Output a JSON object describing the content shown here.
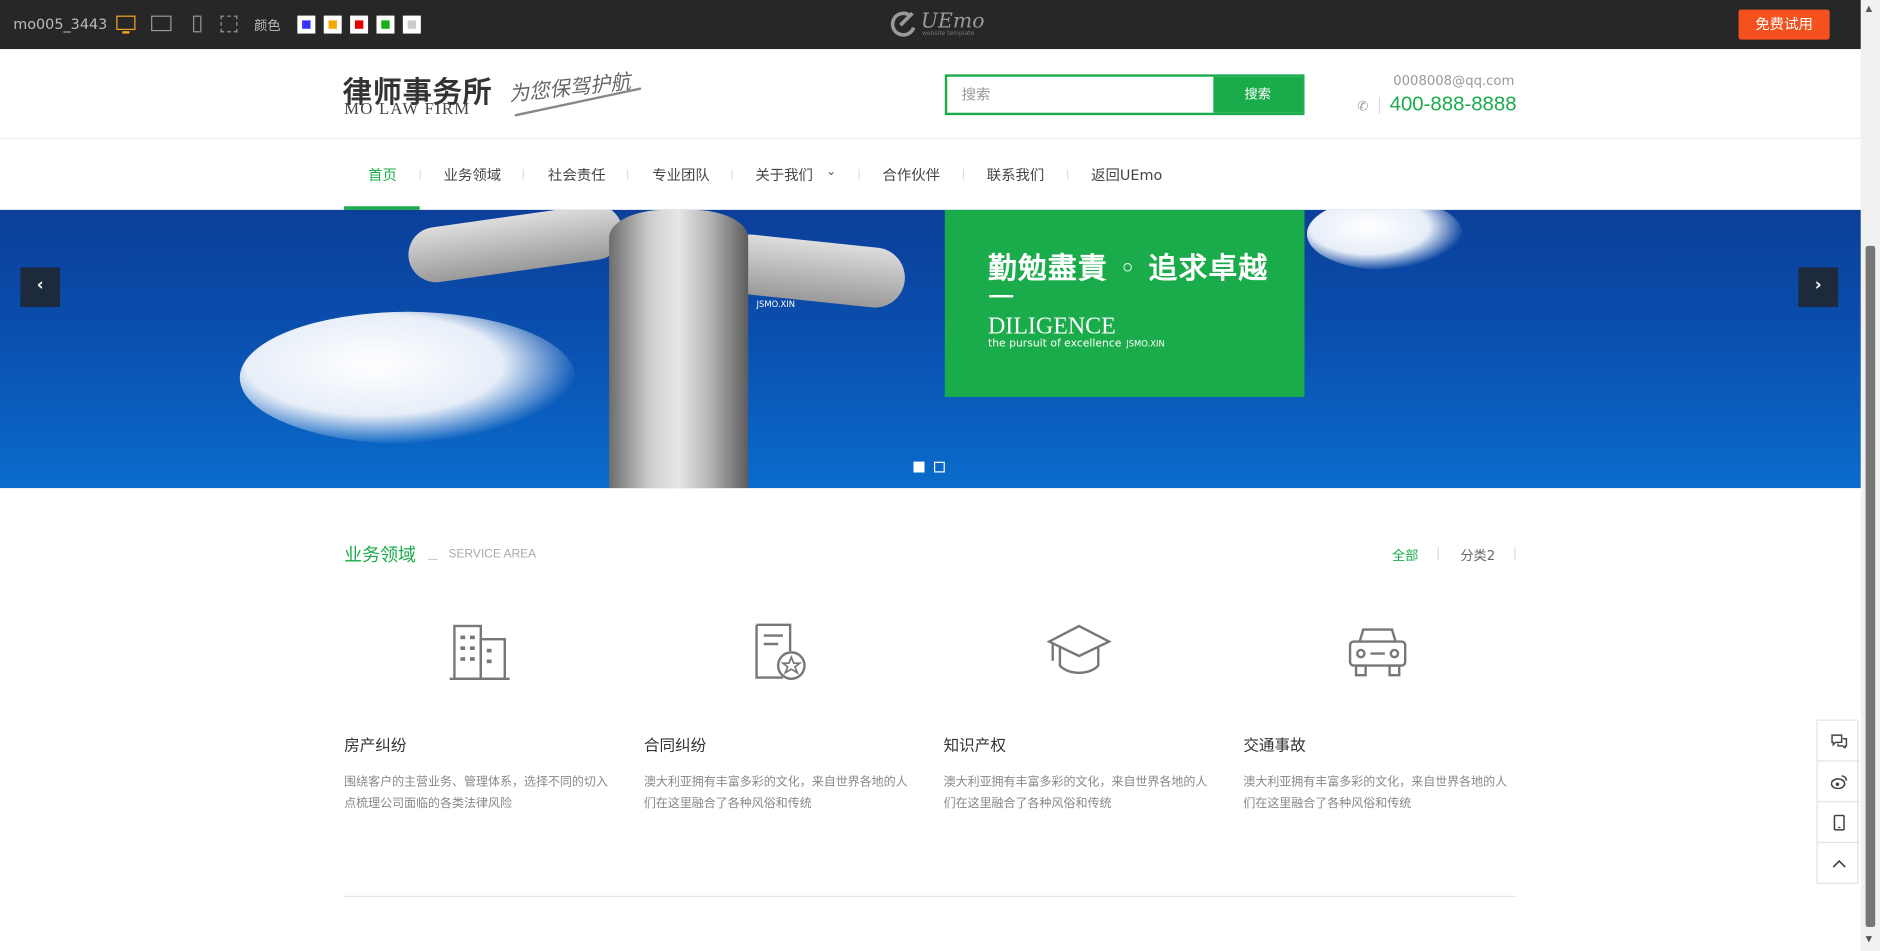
{
  "topbar": {
    "template_id": "mo005_3443",
    "color_label": "颜色",
    "swatches": [
      "#3333ff",
      "#f5a800",
      "#e30000",
      "#13b313",
      "#cccccc"
    ],
    "logo_text": "UEmo",
    "logo_sub": "website template",
    "trial_button": "免费试用",
    "accent": "#f4511e"
  },
  "header": {
    "brand_cn": "律师事务所",
    "brand_en": "MO LAW FIRM",
    "slogan": "为您保驾护航",
    "search_placeholder": "搜索",
    "search_button": "搜索",
    "email": "0008008@qq.com",
    "phone": "400-888-8888"
  },
  "nav": {
    "items": [
      "首页",
      "业务领域",
      "社会责任",
      "专业团队",
      "关于我们",
      "合作伙伴",
      "联系我们",
      "返回UEmo"
    ],
    "active": "首页"
  },
  "banner": {
    "heading": "勤勉盡責 ◦ 追求卓越",
    "english": "DILIGENCE",
    "subtitle": "the pursuit of excellence",
    "watermark": "JSMO.XIN",
    "prev_label": "‹",
    "next_label": "›",
    "slides": 2,
    "current_slide": 1
  },
  "services": {
    "title": "业务领域",
    "subtitle": "SERVICE AREA",
    "filters": [
      "全部",
      "分类2"
    ],
    "items": [
      {
        "title": "房产纠纷",
        "desc": "围绕客户的主营业务、管理体系，选择不同的切入点梳理公司面临的各类法律风险",
        "icon": "building-icon"
      },
      {
        "title": "合同纠纷",
        "desc": "澳大利亚拥有丰富多彩的文化，来自世界各地的人们在这里融合了各种风俗和传统",
        "icon": "certificate-icon"
      },
      {
        "title": "知识产权",
        "desc": "澳大利亚拥有丰富多彩的文化，来自世界各地的人们在这里融合了各种风俗和传统",
        "icon": "graduation-cap-icon"
      },
      {
        "title": "交通事故",
        "desc": "澳大利亚拥有丰富多彩的文化，来自世界各地的人们在这里融合了各种风俗和传统",
        "icon": "car-icon"
      }
    ]
  },
  "float_bar": [
    "chat-icon",
    "weibo-icon",
    "mobile-icon",
    "back-to-top-icon"
  ],
  "colors": {
    "brand_green": "#1aac4a",
    "banner_blue": "#0a4fae"
  }
}
